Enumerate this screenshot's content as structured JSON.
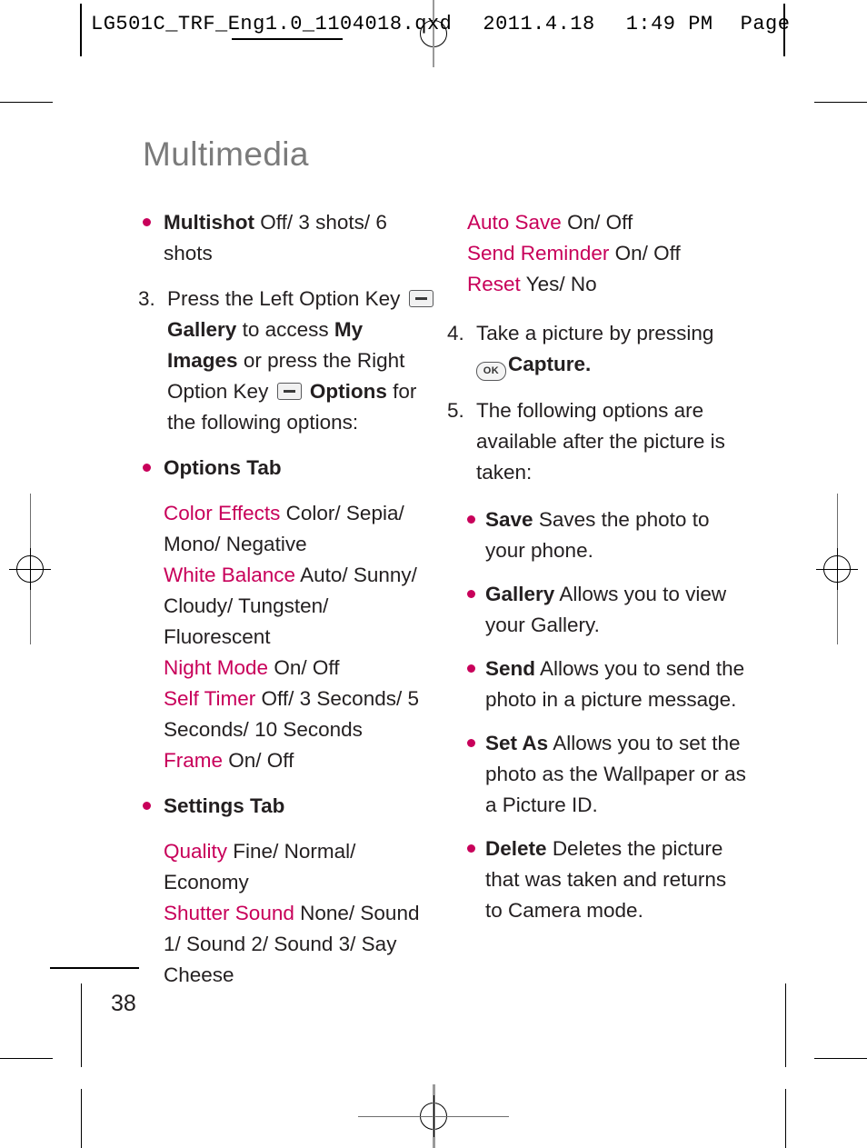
{
  "slug": {
    "file": "LG501C_TRF_Eng1.0_1104018.qxd",
    "date": "2011.4.18",
    "time": "1:49 PM",
    "page_word": "Page"
  },
  "colors": {
    "accent_pink": "#C8005A",
    "title_gray": "#7B7B7B",
    "body_black": "#231F20"
  },
  "chapter": {
    "title": "Multimedia"
  },
  "page": {
    "number": "38"
  },
  "icons": {
    "left_soft_key": "soft-key-icon",
    "right_soft_key": "soft-key-icon",
    "ok_key": "OK"
  },
  "left_column": {
    "multishot": {
      "label": "Multishot",
      "values": "Off/ 3 shots/ 6 shots"
    },
    "step3": {
      "number": "3.",
      "text_part1": "Press the Left Option Key",
      "gallery_label": "Gallery",
      "text_part2": "to access",
      "my_images_label": "My Images",
      "text_part3": "or press the Right Option Key",
      "options_label": "Options",
      "text_part4": "for the following options:"
    },
    "options_tab": {
      "heading": "Options Tab",
      "settings": [
        {
          "name": "Color Effects",
          "values": "Color/ Sepia/ Mono/ Negative"
        },
        {
          "name": "White Balance",
          "values": "Auto/ Sunny/ Cloudy/ Tungsten/ Fluorescent"
        },
        {
          "name": "Night Mode",
          "values": "On/ Off"
        },
        {
          "name": "Self Timer",
          "values": "Off/ 3 Seconds/ 5 Seconds/ 10 Seconds"
        },
        {
          "name": "Frame",
          "values": "On/ Off"
        }
      ]
    },
    "settings_tab": {
      "heading": "Settings Tab",
      "settings": [
        {
          "name": "Quality",
          "values": "Fine/ Normal/ Economy"
        },
        {
          "name": "Shutter Sound",
          "values": "None/ Sound 1/ Sound 2/ Sound 3/ Say Cheese"
        }
      ]
    }
  },
  "right_column": {
    "settings_cont": [
      {
        "name": "Auto Save",
        "values": "On/ Off"
      },
      {
        "name": "Send Reminder",
        "values": "On/ Off"
      },
      {
        "name": "Reset",
        "values": "Yes/ No"
      }
    ],
    "step4": {
      "number": "4.",
      "text_part1": "Take a picture by pressing",
      "capture_label": "Capture."
    },
    "step5": {
      "number": "5.",
      "text": "The following options are available after the picture is taken:"
    },
    "post_capture_options": [
      {
        "name": "Save",
        "description": "Saves the photo to your phone."
      },
      {
        "name": "Gallery",
        "description": "Allows you to view your Gallery."
      },
      {
        "name": "Send",
        "description": "Allows you to send the photo in a picture message."
      },
      {
        "name": "Set As",
        "description": "Allows you to set the photo as the Wallpaper or as a Picture ID."
      },
      {
        "name": "Delete",
        "description": "Deletes the picture that was taken and returns to Camera mode."
      }
    ]
  }
}
